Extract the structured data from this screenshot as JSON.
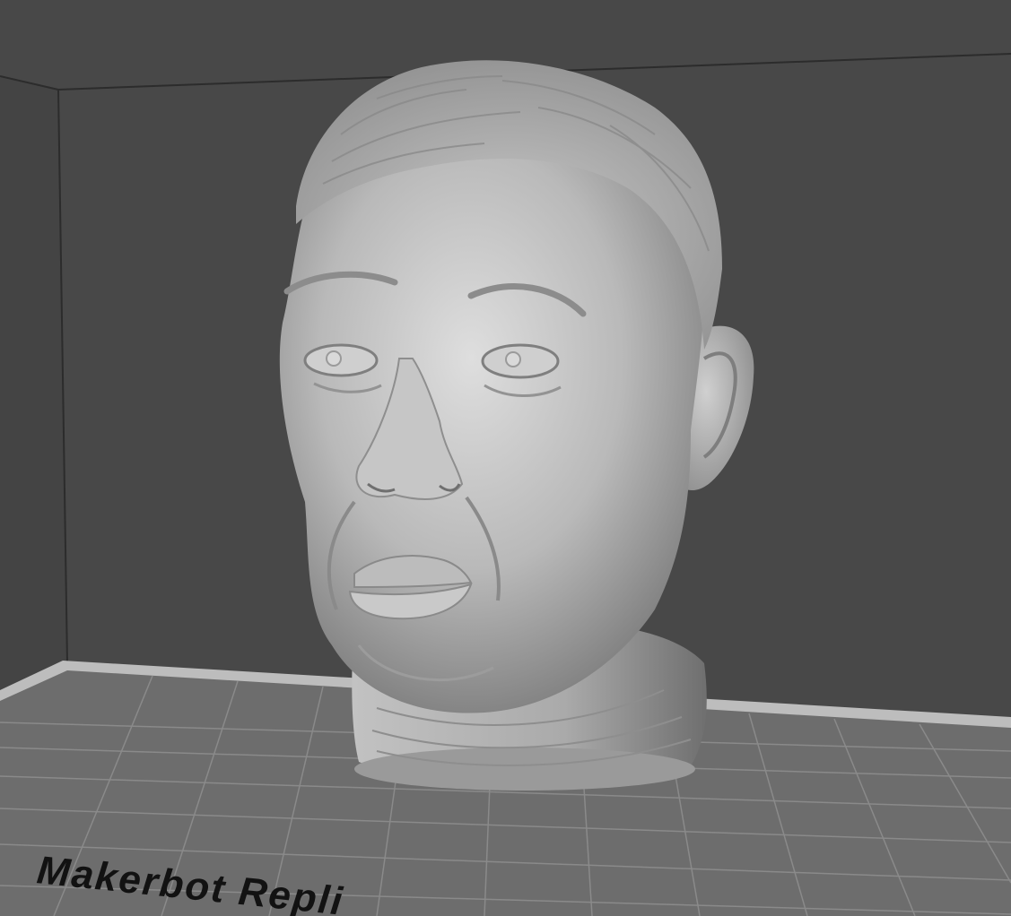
{
  "viewport": {
    "name": "3d-build-viewport",
    "background_color": "#4a4a4a",
    "back_wall_color": "#474747",
    "side_wall_color": "#444444",
    "edge_line_color": "#2c2c2c",
    "grid_line_color": "#8a8a8a"
  },
  "build_plate": {
    "label": "Makerbot Repli",
    "surface_color": "#6d6d6d",
    "rim_color": "#bdbdbd",
    "label_color": "#121212"
  },
  "model": {
    "name": "sculpted-head-bust",
    "shade_color": "#b7b7b7",
    "highlight_color": "#dcdcdc",
    "shadow_color": "#7d7d7d"
  }
}
